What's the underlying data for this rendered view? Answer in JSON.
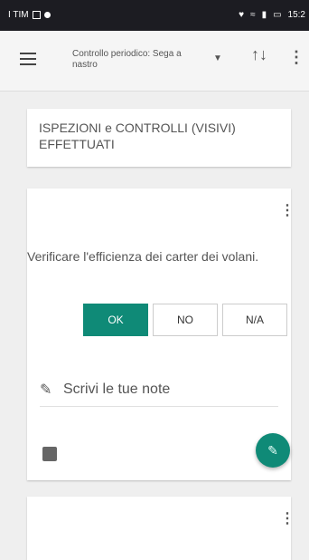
{
  "status_bar": {
    "carrier": "I TIM",
    "time": "15:2"
  },
  "toolbar": {
    "title": "Controllo periodico: Sega a nastro",
    "menu_icon": "hamburger-icon",
    "sort_icon": "sort-icon",
    "more_icon": "more-vert-icon"
  },
  "section": {
    "title": "ISPEZIONI e CONTROLLI (VISIVI) EFFETTUATI"
  },
  "item": {
    "question": "Verificare l'efficienza dei carter dei volani.",
    "options": [
      "OK",
      "NO",
      "N/A"
    ],
    "selected": "OK",
    "notes_placeholder": "Scrivi le tue note",
    "accent_color": "#0f8a77"
  }
}
